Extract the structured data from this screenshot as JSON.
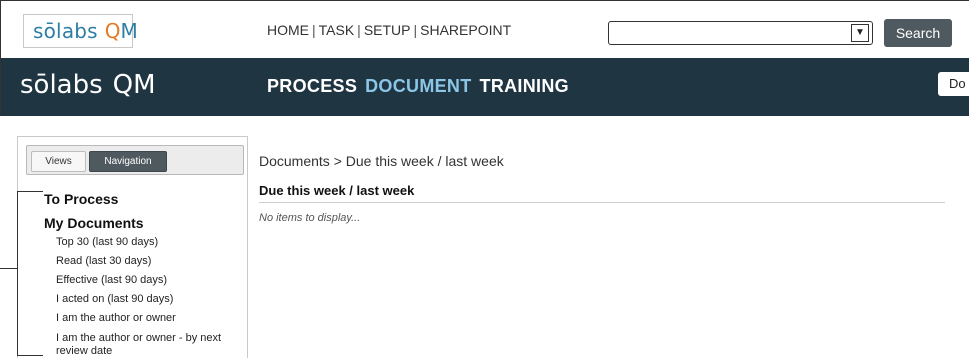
{
  "logo": {
    "brand": "sōlabs",
    "product": "QM"
  },
  "top_nav": {
    "items": [
      "HOME",
      "TASK",
      "SETUP",
      "SHAREPOINT"
    ],
    "separator": "|"
  },
  "search": {
    "selected_value": "",
    "button_label": "Search"
  },
  "main_nav": {
    "items": [
      {
        "label": "PROCESS",
        "active": false
      },
      {
        "label": "DOCUMENT",
        "active": true
      },
      {
        "label": "TRAINING",
        "active": false
      }
    ]
  },
  "banner_button": {
    "label": "Do"
  },
  "left_panel": {
    "tabs": [
      "Views",
      "Navigation"
    ],
    "sections": [
      {
        "label": "To Process",
        "items": []
      },
      {
        "label": "My Documents",
        "items": [
          "Top 30 (last 90 days)",
          "Read (last 30 days)",
          "Effective (last 90 days)",
          "I acted on (last 90 days)",
          "I am the author or owner",
          "I am the author or owner - by next review date"
        ]
      }
    ]
  },
  "breadcrumb": {
    "root": "Documents",
    "separator": ">",
    "current": "Due this week / last week"
  },
  "content": {
    "title": "Due this week / last week",
    "empty_message": "No items to display..."
  },
  "colors": {
    "banner_bg": "#1f3542",
    "active_nav": "#8cc6e6",
    "button_bg": "#4f5a60",
    "logo_blue": "#2d7ea3",
    "logo_orange": "#e27b26"
  }
}
